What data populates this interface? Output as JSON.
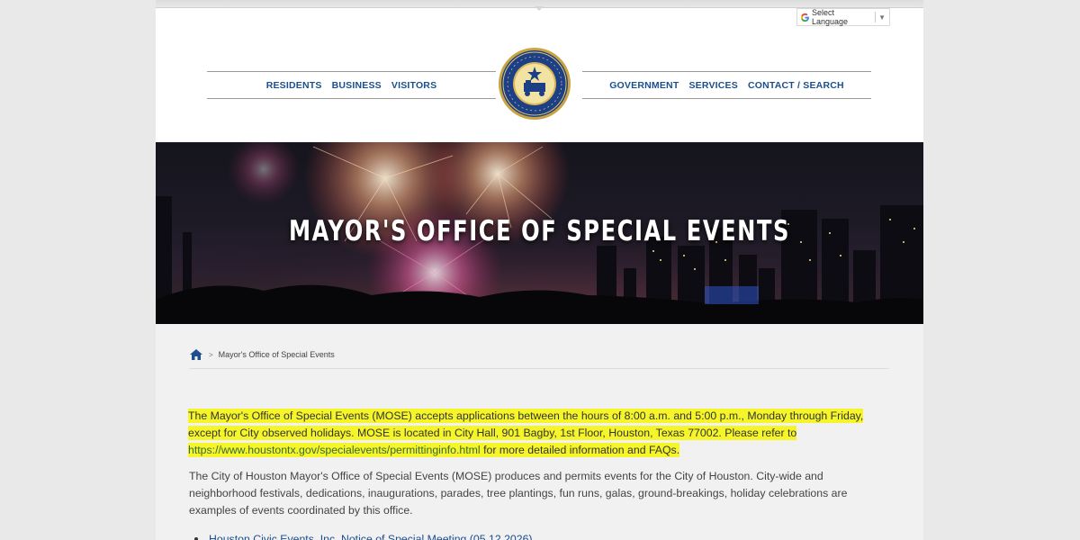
{
  "language": {
    "label": "Select Language",
    "arrow": "▼"
  },
  "nav": {
    "left": [
      "RESIDENTS",
      "BUSINESS",
      "VISITORS"
    ],
    "right": [
      "GOVERNMENT",
      "SERVICES",
      "CONTACT / SEARCH"
    ]
  },
  "hero": {
    "title": "MAYOR'S OFFICE OF SPECIAL EVENTS"
  },
  "breadcrumb": {
    "separator": ">",
    "current": "Mayor's Office of Special Events"
  },
  "notice": {
    "text_before": " The Mayor's Office of Special Events (MOSE) accepts applications between the hours of 8:00 a.m. and 5:00 p.m., Monday through Friday, except for City observed holidays. MOSE is located in City Hall, 901 Bagby, 1st Floor, Houston, Texas 77002. Please refer to ",
    "link": "https://www.houstontx.gov/specialevents/permittinginfo.html",
    "text_after": " for more detailed information and FAQs."
  },
  "description": "The City of Houston Mayor's Office of Special Events (MOSE) produces and permits events for the City of Houston. City-wide and neighborhood festivals, dedications, inaugurations, parades, tree plantings, fun runs, galas, ground-breakings, holiday celebrations are examples of events coordinated by this office.",
  "links": [
    "Houston Civic Events, Inc. Notice of Special Meeting (05.12.2026)"
  ],
  "colors": {
    "nav_blue": "#1b4f8f",
    "highlight": "#f5f529",
    "link_green": "#37693a"
  }
}
